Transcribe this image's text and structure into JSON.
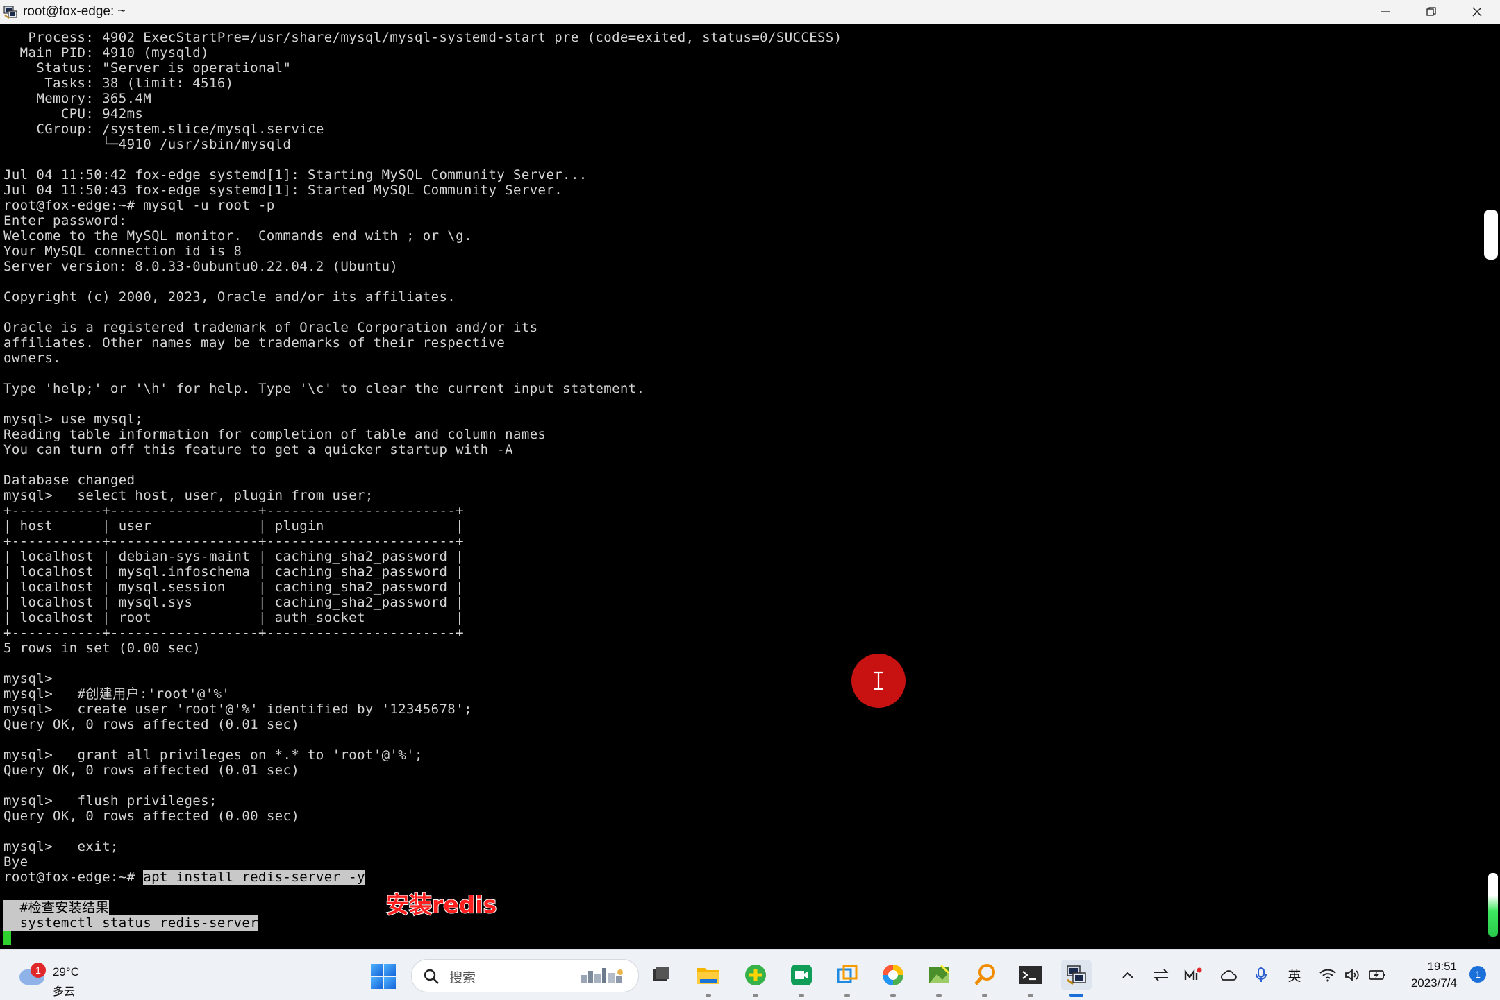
{
  "window": {
    "title": "root@fox-edge: ~"
  },
  "terminal": {
    "lines_before": [
      "   Process: 4902 ExecStartPre=/usr/share/mysql/mysql-systemd-start pre (code=exited, status=0/SUCCESS)",
      "  Main PID: 4910 (mysqld)",
      "    Status: \"Server is operational\"",
      "     Tasks: 38 (limit: 4516)",
      "    Memory: 365.4M",
      "       CPU: 942ms",
      "    CGroup: /system.slice/mysql.service",
      "            └─4910 /usr/sbin/mysqld",
      "",
      "Jul 04 11:50:42 fox-edge systemd[1]: Starting MySQL Community Server...",
      "Jul 04 11:50:43 fox-edge systemd[1]: Started MySQL Community Server.",
      "root@fox-edge:~# mysql -u root -p",
      "Enter password:",
      "Welcome to the MySQL monitor.  Commands end with ; or \\g.",
      "Your MySQL connection id is 8",
      "Server version: 8.0.33-0ubuntu0.22.04.2 (Ubuntu)",
      "",
      "Copyright (c) 2000, 2023, Oracle and/or its affiliates.",
      "",
      "Oracle is a registered trademark of Oracle Corporation and/or its",
      "affiliates. Other names may be trademarks of their respective",
      "owners.",
      "",
      "Type 'help;' or '\\h' for help. Type '\\c' to clear the current input statement.",
      "",
      "mysql> use mysql;",
      "Reading table information for completion of table and column names",
      "You can turn off this feature to get a quicker startup with -A",
      "",
      "Database changed",
      "mysql>   select host, user, plugin from user;",
      "+-----------+------------------+-----------------------+",
      "| host      | user             | plugin                |",
      "+-----------+------------------+-----------------------+",
      "| localhost | debian-sys-maint | caching_sha2_password |",
      "| localhost | mysql.infoschema | caching_sha2_password |",
      "| localhost | mysql.session    | caching_sha2_password |",
      "| localhost | mysql.sys        | caching_sha2_password |",
      "| localhost | root             | auth_socket           |",
      "+-----------+------------------+-----------------------+",
      "5 rows in set (0.00 sec)",
      "",
      "mysql>",
      "mysql>   #创建用户:'root'@'%'",
      "mysql>   create user 'root'@'%' identified by '12345678';",
      "Query OK, 0 rows affected (0.01 sec)",
      "",
      "mysql>   grant all privileges on *.* to 'root'@'%';",
      "Query OK, 0 rows affected (0.01 sec)",
      "",
      "mysql>   flush privileges;",
      "Query OK, 0 rows affected (0.00 sec)",
      "",
      "mysql>   exit;",
      "Bye"
    ],
    "prompt": "root@fox-edge:~# ",
    "typed_command": "apt install redis-server -y",
    "pasted_comment": "  #检查安装结果",
    "pasted_command": "  systemctl status redis-server"
  },
  "overlay": {
    "subtitle": "安装redis"
  },
  "taskbar": {
    "weather": {
      "temp": "29°C",
      "condition": "多云",
      "badge": "1"
    },
    "search_placeholder": "搜索",
    "apps": [
      "file-explorer-stack",
      "file-explorer",
      "plus-app",
      "meeting-app",
      "copy-app",
      "browser",
      "image-editor",
      "search-tool",
      "terminal",
      "remote-desktop"
    ],
    "tray": {
      "ime": "英"
    },
    "clock": {
      "time": "19:51",
      "date": "2023/7/4"
    },
    "notifications": "1"
  },
  "colors": {
    "terminal_bg": "#000000",
    "terminal_fg": "#d4d4d4",
    "cursor": "#2ed12e",
    "subtitle": "#ff2020",
    "click_indicator": "#c81212"
  }
}
